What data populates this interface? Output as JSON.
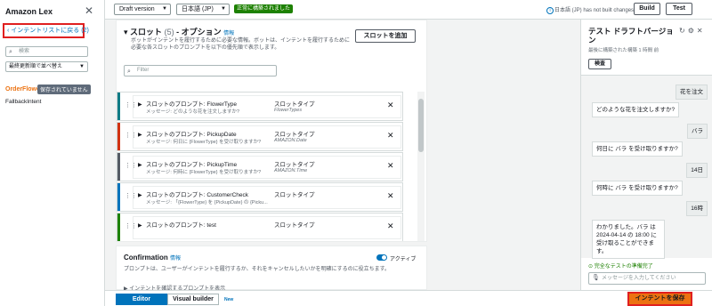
{
  "sidebar": {
    "title": "Amazon Lex",
    "back_link": "インテントリストに戻る (2)",
    "search_placeholder": "検索",
    "sort_value": "最終更新順で並べ替え",
    "intents": [
      {
        "name": "OrderFlowers",
        "badge": "保存されていません"
      },
      {
        "name": "FallbackIntent"
      }
    ]
  },
  "toolbar": {
    "version": "Draft version",
    "language": "日本語 (JP)",
    "status": "正常に構築されました",
    "info": "日本語 (JP) has not built changes.",
    "build_label": "Build",
    "test_label": "Test"
  },
  "slots": {
    "title": "スロット",
    "count": "(5)",
    "title_suffix": "- オプション",
    "info": "情報",
    "desc": "ボットがインテントを履行するために必要な情報。ボットは、インテントを履行するために必要な各スロットのプロンプトを以下の優先順で表示します。",
    "add_label": "スロットを追加",
    "filter_placeholder": "Filter",
    "type_label": "スロットタイプ",
    "items": [
      {
        "prompt": "スロットのプロンプト: FlowerType",
        "message": "メッセージ: どのような花を注文しますか?",
        "type": "FlowerTypes",
        "color": "#0f7b85"
      },
      {
        "prompt": "スロットのプロンプト: PickupDate",
        "message": "メッセージ: 何日に {FlowerType} を受け取りますか?",
        "type": "AMAZON.Date",
        "color": "#d13212"
      },
      {
        "prompt": "スロットのプロンプト: PickupTime",
        "message": "メッセージ: 何時に {FlowerType} を受け取りますか?",
        "type": "AMAZON.Time",
        "color": "#545b64"
      },
      {
        "prompt": "スロットのプロンプト: CustomerCheck",
        "message": "メッセージ: 「{FlowerType} を {PickupDate} の {Picku...",
        "type": "",
        "color": "#0073bb"
      },
      {
        "prompt": "スロットのプロンプト: test",
        "message": "",
        "type": "",
        "color": "#1d8102"
      }
    ]
  },
  "confirmation": {
    "title": "Confirmation",
    "info": "情報",
    "desc": "プロンプトは、ユーザーがインテントを履行するか、それをキャンセルしたいかを明確にするのに役立ちます。",
    "toggle_label": "アクティブ",
    "row": "インテントを確認するプロンプトを表示"
  },
  "bottom": {
    "editor_label": "Editor",
    "visual_label": "Visual builder",
    "new_badge": "New",
    "save_label": "インテントを保存"
  },
  "test_panel": {
    "title": "テスト ドラフトバージョン",
    "built": "最後に構築された構築 1 時間 前",
    "inspect_label": "検査",
    "messages": [
      {
        "role": "user",
        "text": "花を注文"
      },
      {
        "role": "bot",
        "text": "どのような花を注文しますか?"
      },
      {
        "role": "user",
        "text": "バラ"
      },
      {
        "role": "bot",
        "text": "何日に バラ を受け取りますか?"
      },
      {
        "role": "user",
        "text": "14日"
      },
      {
        "role": "bot",
        "text": "何時に バラ を受け取りますか?"
      },
      {
        "role": "user",
        "text": "16時"
      },
      {
        "role": "bot",
        "text": "わかりました。バラ は 2024-04-14 の 18:00 に受け取ることができます。"
      }
    ],
    "success": "完全なテストの準備完了",
    "input_placeholder": "メッセージを入力してください"
  }
}
